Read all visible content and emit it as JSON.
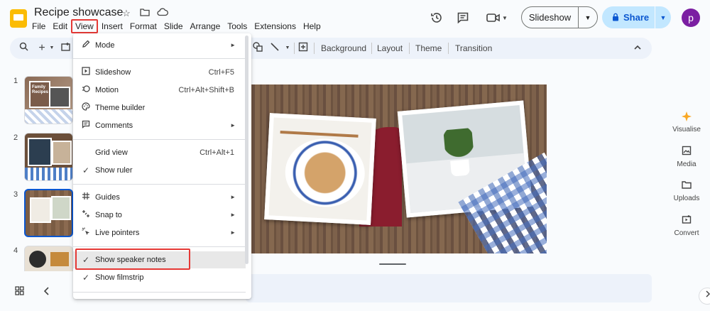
{
  "header": {
    "title": "Recipe showcase",
    "menus": [
      "File",
      "Edit",
      "View",
      "Insert",
      "Format",
      "Slide",
      "Arrange",
      "Tools",
      "Extensions",
      "Help"
    ],
    "slideshow_label": "Slideshow",
    "share_label": "Share",
    "avatar_letter": "p"
  },
  "toolbar": {
    "background": "Background",
    "layout": "Layout",
    "theme": "Theme",
    "transition": "Transition"
  },
  "filmstrip": {
    "numbers": [
      "1",
      "2",
      "3",
      "4"
    ],
    "thumb1_caption": "Family Recipes",
    "selected": 3
  },
  "side_panel": {
    "visualise": "Visualise",
    "media": "Media",
    "uploads": "Uploads",
    "convert": "Convert"
  },
  "view_menu": {
    "mode": "Mode",
    "slideshow": "Slideshow",
    "slideshow_shortcut": "Ctrl+F5",
    "motion": "Motion",
    "motion_shortcut": "Ctrl+Alt+Shift+B",
    "theme_builder": "Theme builder",
    "comments": "Comments",
    "grid_view": "Grid view",
    "grid_view_shortcut": "Ctrl+Alt+1",
    "show_ruler": "Show ruler",
    "guides": "Guides",
    "snap_to": "Snap to",
    "live_pointers": "Live pointers",
    "show_speaker_notes": "Show speaker notes",
    "show_filmstrip": "Show filmstrip"
  },
  "icons": {
    "check": "✓",
    "submenu": "►",
    "caret": "▼"
  },
  "colors": {
    "highlight_border": "#e53935",
    "share_bg": "#c2e7ff",
    "avatar_bg": "#7b1fa2",
    "logo": "#fbbc04",
    "selection": "#0b57d0"
  }
}
